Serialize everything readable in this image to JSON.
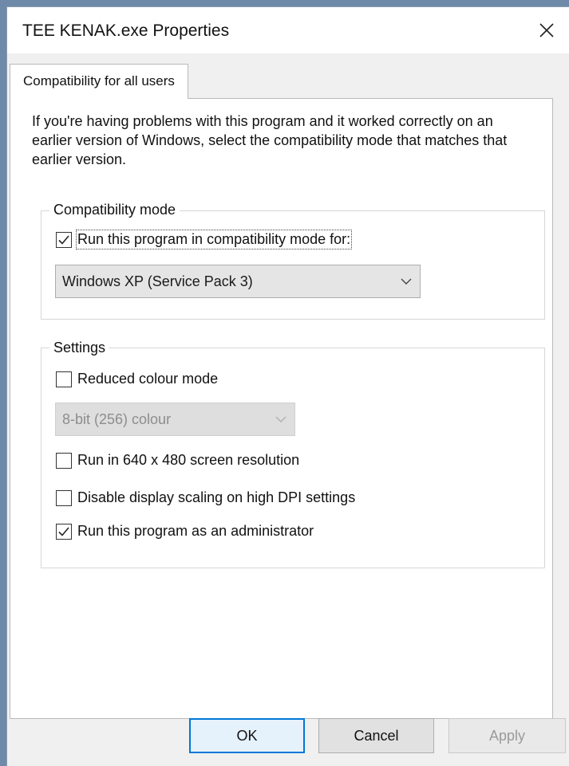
{
  "window": {
    "title": "TEE KENAK.exe Properties"
  },
  "tabs": [
    {
      "label": "Compatibility for all users",
      "active": true
    }
  ],
  "intro_text": "If you're having problems with this program and it worked correctly on an earlier version of Windows, select the compatibility mode that matches that earlier version.",
  "compatibility_mode": {
    "legend": "Compatibility mode",
    "checkbox": {
      "label": "Run this program in compatibility mode for:",
      "checked": true
    },
    "select": {
      "value": "Windows XP (Service Pack 3)",
      "enabled": true
    }
  },
  "settings": {
    "legend": "Settings",
    "reduced_colour": {
      "label": "Reduced colour mode",
      "checked": false
    },
    "colour_select": {
      "value": "8-bit (256) colour",
      "enabled": false
    },
    "resolution": {
      "label": "Run in 640 x 480 screen resolution",
      "checked": false
    },
    "dpi_scaling": {
      "label": "Disable display scaling on high DPI settings",
      "checked": false
    },
    "admin": {
      "label": "Run this program as an administrator",
      "checked": true
    }
  },
  "buttons": {
    "ok": "OK",
    "cancel": "Cancel",
    "apply": "Apply"
  },
  "colors": {
    "accent": "#0078d7",
    "background": "#f0f0f0",
    "panel": "#ffffff"
  }
}
